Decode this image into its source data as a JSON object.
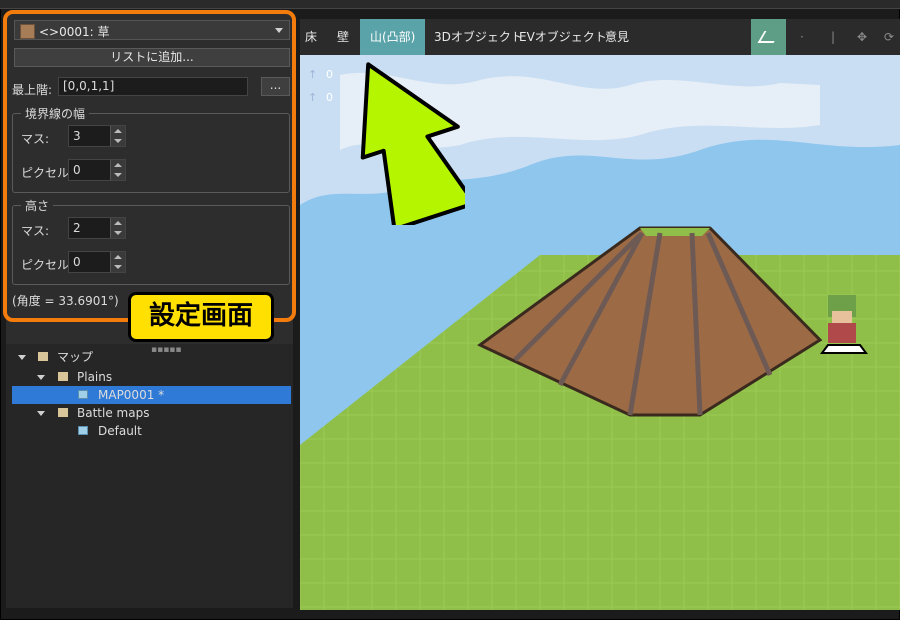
{
  "properties": {
    "tile_name": "<>0001: 草",
    "add_to_list_label": "リストに追加...",
    "top_floor_label": "最上階:",
    "top_floor_value": "[0,0,1,1]",
    "browse_label": "...",
    "border_group": {
      "title": "境界線の幅",
      "cells_label": "マス:",
      "cells_value": "3",
      "pixels_label": "ピクセル:",
      "pixels_value": "0"
    },
    "height_group": {
      "title": "高さ",
      "cells_label": "マス:",
      "cells_value": "2",
      "pixels_label": "ピクセル:",
      "pixels_value": "0"
    },
    "angle_text": "(角度 = 33.6901°)"
  },
  "annotation": {
    "callout": "設定画面",
    "box_color": "#f47c0c",
    "callout_color": "#ffe000",
    "arrow_color": "#b6f500"
  },
  "map_tree": [
    {
      "label": "マップ",
      "type": "folder",
      "level": 0
    },
    {
      "label": "Plains",
      "type": "folder",
      "level": 1
    },
    {
      "label": "MAP0001 *",
      "type": "map",
      "level": 2,
      "selected": true
    },
    {
      "label": "Battle maps",
      "type": "folder",
      "level": 1
    },
    {
      "label": "Default",
      "type": "map",
      "level": 2
    }
  ],
  "menu": {
    "items": [
      {
        "label": "床"
      },
      {
        "label": "壁"
      },
      {
        "label": "山(凸部)",
        "active": true
      },
      {
        "label": "3Dオブジェクト"
      },
      {
        "label": "EVオブジェクト"
      },
      {
        "label": "意見"
      }
    ],
    "active_color": "#5aa3a8"
  },
  "viewport": {
    "coord_a": "0",
    "coord_b": "0",
    "colors": {
      "sky": "#8ec6ee",
      "grass": "#8fbf48",
      "mountain": "#9c6b45"
    }
  }
}
